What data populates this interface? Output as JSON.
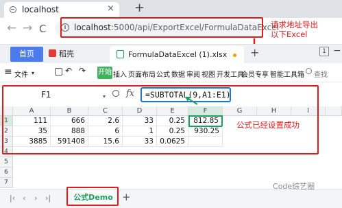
{
  "browser": {
    "tab_title": "localhost",
    "tab_close": "×",
    "new_tab": "+",
    "back": "←",
    "forward": "→",
    "reload": "C",
    "url_host": "localhost",
    "url_path": ":5000/api/ExportExcel/FormulaDataExcel"
  },
  "annotations": {
    "url_note": "请求地址导出\n以下Excel",
    "grid_note": "公式已经设置成功",
    "watermark": "Code综艺圈"
  },
  "app": {
    "home_tab": "首页",
    "brand_tab": "稻壳",
    "file_tab": "FormulaDataExcel (1).xlsx",
    "window_controls": [
      "1",
      "−"
    ],
    "ribbon": {
      "menu_icon": "≡",
      "file": "文件",
      "start": "开始",
      "items": [
        "插入",
        "页面布局",
        "公式",
        "数据",
        "审阅",
        "视图",
        "开发工具",
        "会员专享",
        "智能工具箱"
      ],
      "search": "查找"
    }
  },
  "formula_bar": {
    "name_box": "F1",
    "fx": "fx",
    "formula": "=SUBTOTAL(9,A1:E1)"
  },
  "sheet": {
    "columns": [
      "A",
      "B",
      "C",
      "D",
      "E",
      "F",
      "G",
      "H",
      "I"
    ],
    "rows": [
      "1",
      "2",
      "3",
      "4",
      "5",
      "6",
      "7"
    ],
    "data": [
      [
        "111",
        "666",
        "2.6",
        "33",
        "0.25",
        "812.85"
      ],
      [
        "35",
        "888",
        "6",
        "1",
        "0.25",
        "930.25"
      ],
      [
        "3885",
        "591408",
        "15.6",
        "33",
        "0.0625",
        ""
      ]
    ],
    "selected_cell": "F1",
    "sheet_tab": "公式Demo",
    "add_sheet": "+"
  },
  "colors": {
    "highlight_red": "#e11b1b",
    "formula_blue": "#1a73e8",
    "wps_green": "#18a05e"
  }
}
